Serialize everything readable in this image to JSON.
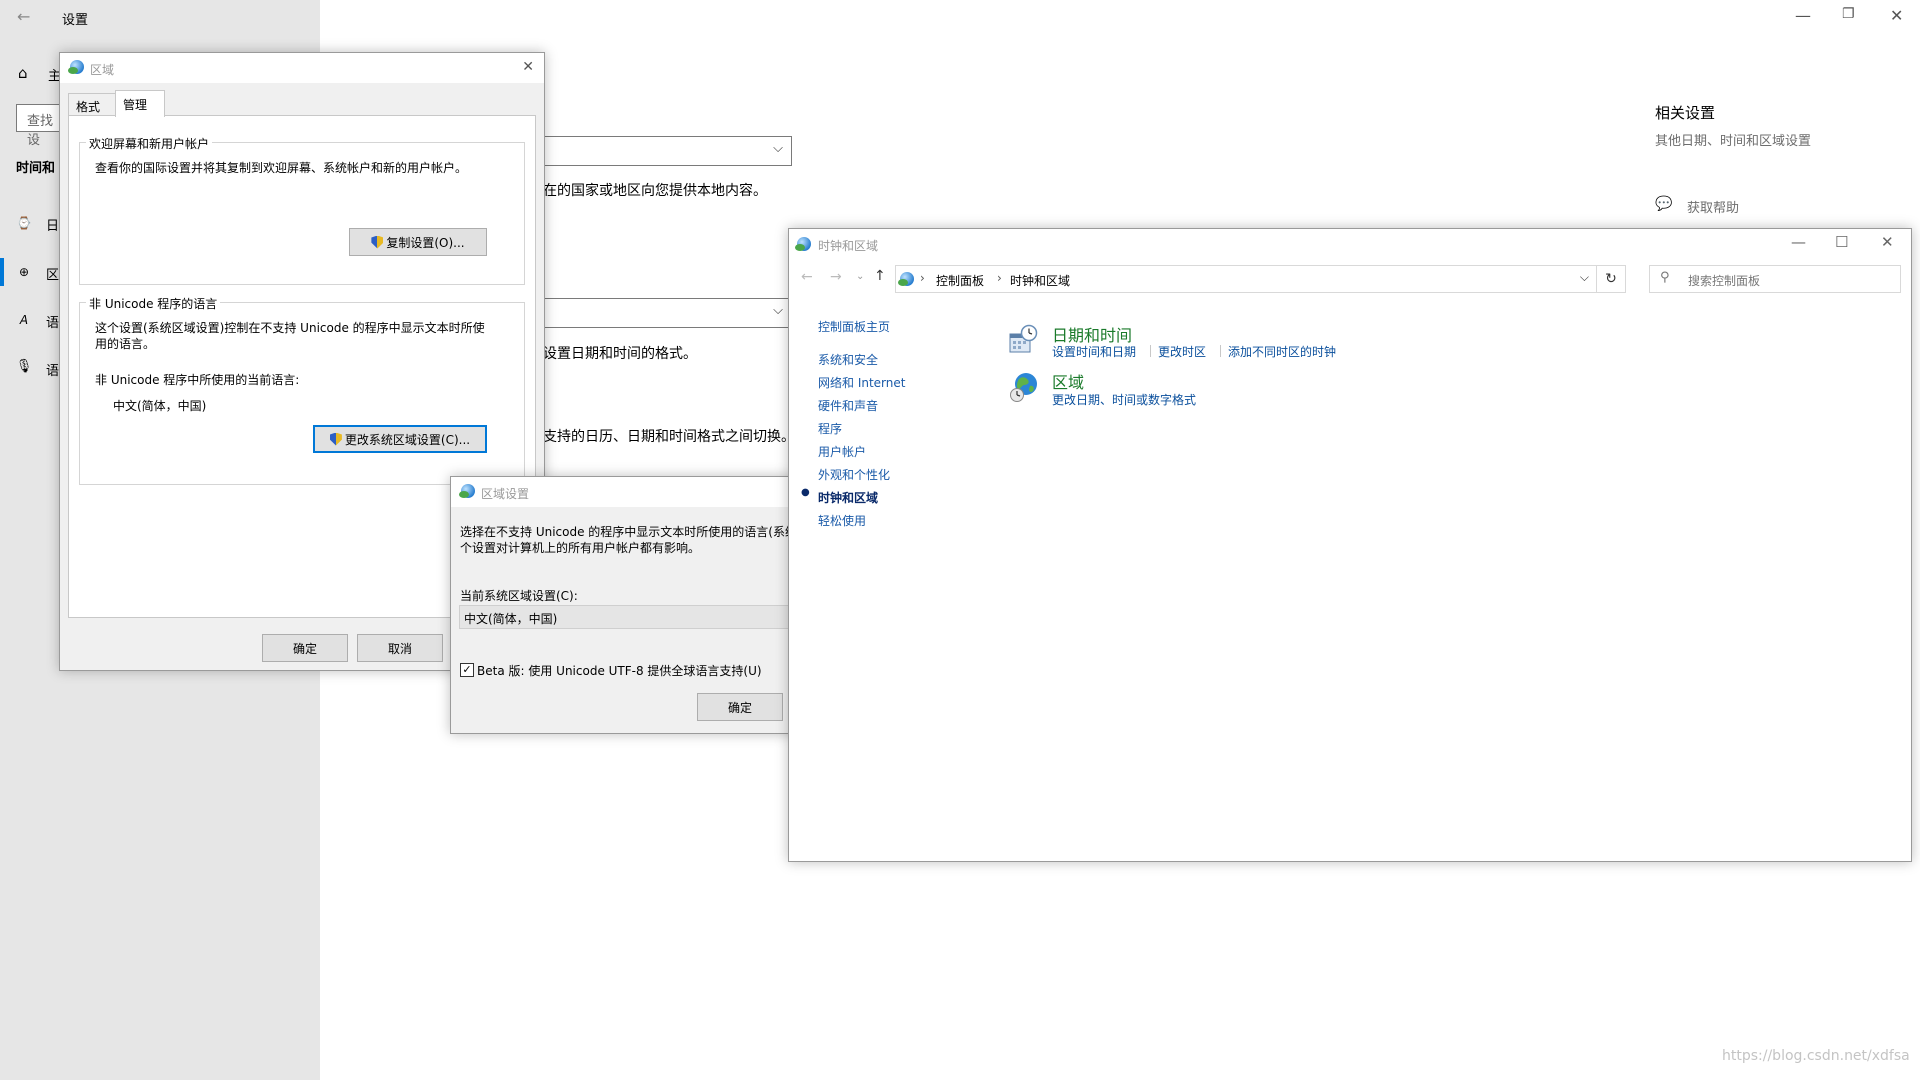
{
  "settings": {
    "title": "设置",
    "window_controls": {
      "minimize": "—",
      "restore": "❐",
      "close": "✕"
    },
    "sidebar": {
      "home_label": "主",
      "search_placeholder": "查找设",
      "section_title": "时间和",
      "items": [
        {
          "icon": "calendar-clock-icon",
          "glyph": "⌚",
          "label": "日"
        },
        {
          "icon": "region-globe-icon",
          "glyph": "⊕",
          "label": "区"
        },
        {
          "icon": "language-icon",
          "glyph": "A",
          "label": "语"
        },
        {
          "icon": "microphone-icon",
          "glyph": "🎙",
          "label": "语"
        }
      ]
    },
    "main": {
      "region_desc": "在的国家或地区向您提供本地内容。",
      "format_desc": "设置日期和时间的格式。",
      "calendar_desc": "支持的日历、日期和时间格式之间切换。"
    },
    "related": {
      "title": "相关设置",
      "link": "其他日期、时间和区域设置",
      "help": "获取帮助"
    }
  },
  "region_dialog": {
    "title": "区域",
    "tabs": [
      "格式",
      "管理"
    ],
    "active_tab": "管理",
    "welcome_group": {
      "label": "欢迎屏幕和新用户帐户",
      "desc": "查看你的国际设置并将其复制到欢迎屏幕、系统帐户和新的用户帐户。",
      "button": "复制设置(O)..."
    },
    "unicode_group": {
      "label": "非 Unicode 程序的语言",
      "desc_line1": "这个设置(系统区域设置)控制在不支持 Unicode 的程序中显示文本时所使",
      "desc_line2": "用的语言。",
      "current_label": "非 Unicode 程序中所使用的当前语言:",
      "current_value": "中文(简体，中国)",
      "button": "更改系统区域设置(C)..."
    },
    "ok": "确定",
    "cancel": "取消",
    "close": "✕"
  },
  "region_settings_dialog": {
    "title": "区域设置",
    "desc_line1": "选择在不支持 Unicode 的程序中显示文本时所使用的语言(系统",
    "desc_line2": "个设置对计算机上的所有用户帐户都有影响。",
    "current_label": "当前系统区域设置(C):",
    "current_value": "中文(简体，中国)",
    "beta_checkbox": "Beta 版: 使用 Unicode UTF-8 提供全球语言支持(U)",
    "beta_checked": true,
    "ok": "确定"
  },
  "control_panel": {
    "title": "时钟和区域",
    "window_controls": {
      "minimize": "—",
      "maximize": "☐",
      "close": "✕"
    },
    "breadcrumb": [
      "控制面板",
      "时钟和区域"
    ],
    "search_placeholder": "搜索控制面板",
    "sidebar": {
      "home": "控制面板主页",
      "items": [
        "系统和安全",
        "网络和 Internet",
        "硬件和声音",
        "程序",
        "用户帐户",
        "外观和个性化",
        "时钟和区域",
        "轻松使用"
      ],
      "active": "时钟和区域"
    },
    "categories": [
      {
        "title": "日期和时间",
        "icon": "date-time-icon",
        "links": [
          "设置时间和日期",
          "更改时区",
          "添加不同时区的时钟"
        ]
      },
      {
        "title": "区域",
        "icon": "region-icon",
        "links": [
          "更改日期、时间或数字格式"
        ]
      }
    ]
  },
  "watermark": "https://blog.csdn.net/xdfsa"
}
